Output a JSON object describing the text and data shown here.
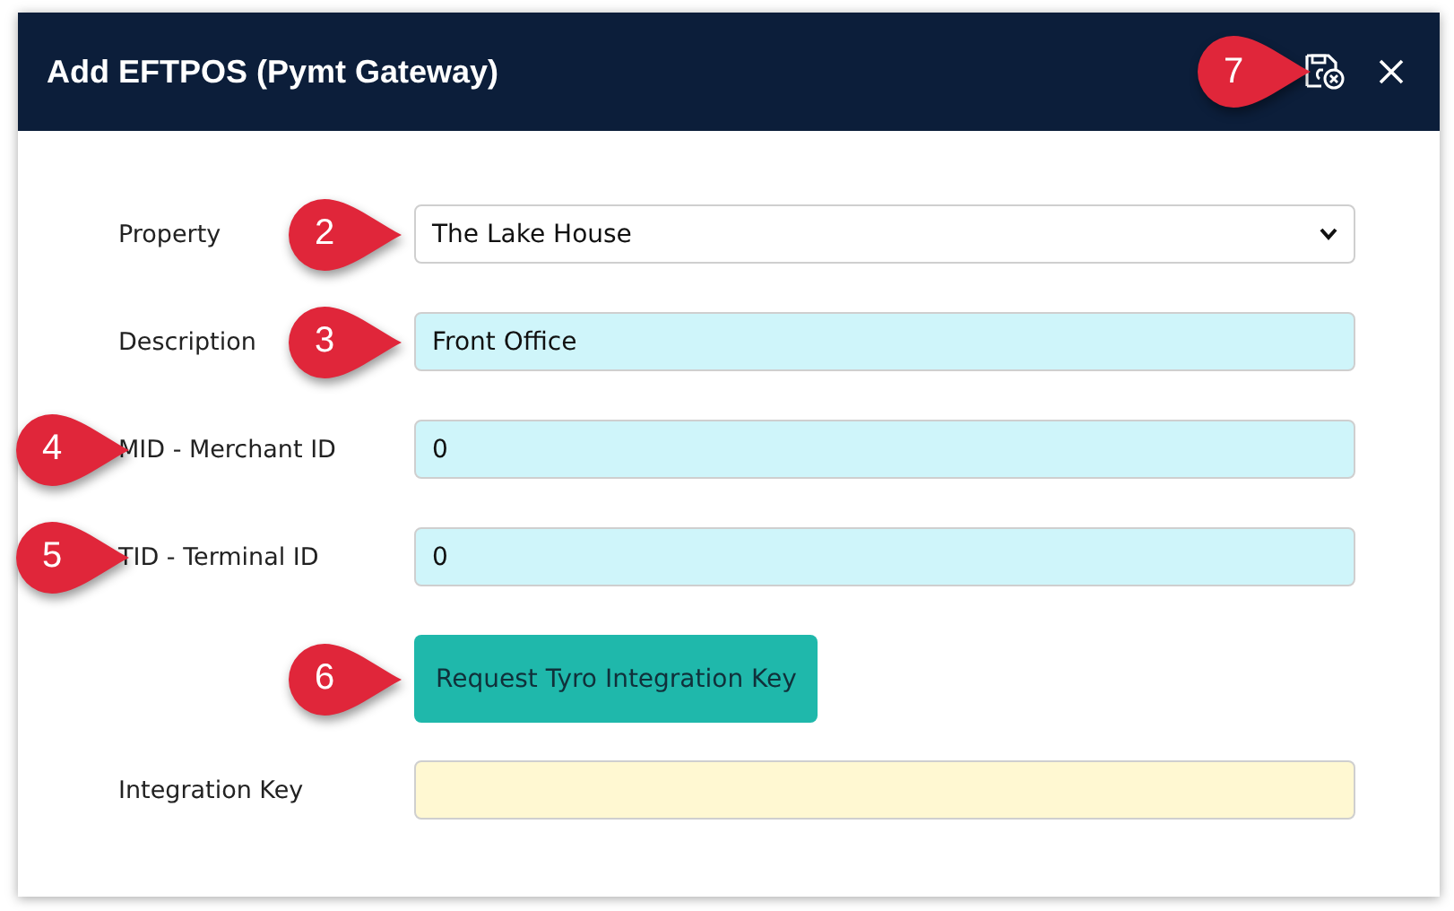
{
  "window": {
    "title": "Add EFTPOS (Pymt Gateway)",
    "header_callout": "7"
  },
  "rows": [
    {
      "kind": "select",
      "label": "Property",
      "value": "The Lake House",
      "readonly": false,
      "field_callout": "2"
    },
    {
      "kind": "input",
      "label": "Description",
      "value": "Front Office",
      "readonly": false,
      "field_callout": "3"
    },
    {
      "kind": "input",
      "label": "MID - Merchant ID",
      "value": "0",
      "readonly": false,
      "label_callout": "4"
    },
    {
      "kind": "input",
      "label": "TID - Terminal ID",
      "value": "0",
      "readonly": false,
      "label_callout": "5"
    },
    {
      "kind": "button",
      "label": "Request Tyro Integration Key",
      "field_callout": "6"
    },
    {
      "kind": "input",
      "label": "Integration Key",
      "readonly": true
    }
  ]
}
